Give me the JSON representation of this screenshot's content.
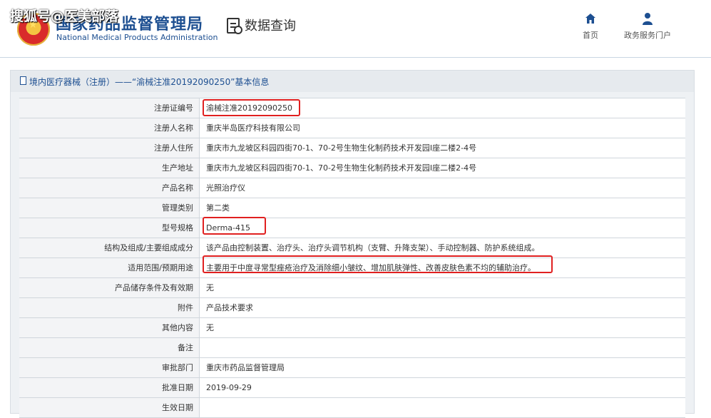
{
  "watermark": "搜狐号@医美部落",
  "header": {
    "org_name_cn": "国家药品监督管理局",
    "org_name_en": "National Medical Products Administration",
    "page_title": "数据查询",
    "nav": [
      {
        "label": "首页",
        "icon": "home-icon"
      },
      {
        "label": "政务服务门户",
        "icon": "user-icon"
      }
    ]
  },
  "panel": {
    "title": "境内医疗器械（注册）——“渝械注准20192090250”基本信息"
  },
  "rows": [
    {
      "label": "注册证编号",
      "value": "渝械注准20192090250"
    },
    {
      "label": "注册人名称",
      "value": "重庆半岛医疗科技有限公司"
    },
    {
      "label": "注册人住所",
      "value": "重庆市九龙坡区科园四街70-1、70-2号生物生化制药技术开发园I座二楼2-4号"
    },
    {
      "label": "生产地址",
      "value": "重庆市九龙坡区科园四街70-1、70-2号生物生化制药技术开发园I座二楼2-4号"
    },
    {
      "label": "产品名称",
      "value": "光照治疗仪"
    },
    {
      "label": "管理类别",
      "value": "第二类"
    },
    {
      "label": "型号规格",
      "value": "Derma-415"
    },
    {
      "label": "结构及组成/主要组成成分",
      "value": "该产品由控制装置、治疗头、治疗头调节机构（支臂、升降支架）、手动控制器、防护系统组成。"
    },
    {
      "label": "适用范围/预期用途",
      "value": "主要用于中度寻常型痤疮治疗及消除细小皱纹、增加肌肤弹性、改善皮肤色素不均的辅助治疗。"
    },
    {
      "label": "产品储存条件及有效期",
      "value": "无"
    },
    {
      "label": "附件",
      "value": "产品技术要求"
    },
    {
      "label": "其他内容",
      "value": "无"
    },
    {
      "label": "备注",
      "value": ""
    },
    {
      "label": "审批部门",
      "value": "重庆市药品监督管理局"
    },
    {
      "label": "批准日期",
      "value": "2019-09-29"
    },
    {
      "label": "生效日期",
      "value": ""
    }
  ],
  "colors": {
    "brand": "#1d4f91",
    "highlight": "#e02020"
  }
}
